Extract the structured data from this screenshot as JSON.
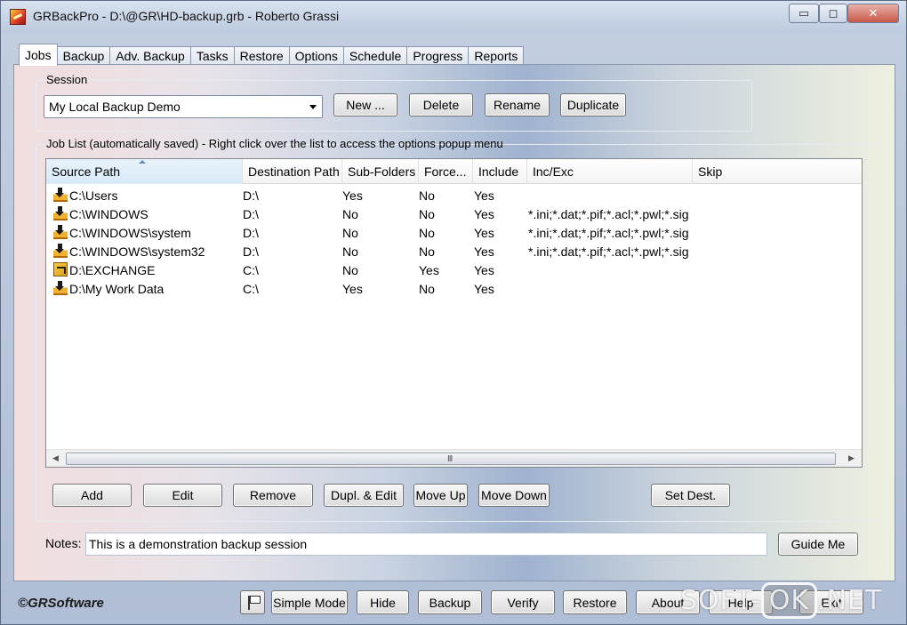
{
  "window": {
    "title": "GRBackPro - D:\\@GR\\HD-backup.grb - Roberto Grassi",
    "caption_min": "▭",
    "caption_max": "◻",
    "caption_close": "✕"
  },
  "tabs": [
    {
      "label": "Jobs",
      "active": true
    },
    {
      "label": "Backup"
    },
    {
      "label": "Adv. Backup"
    },
    {
      "label": "Tasks"
    },
    {
      "label": "Restore"
    },
    {
      "label": "Options"
    },
    {
      "label": "Schedule"
    },
    {
      "label": "Progress"
    },
    {
      "label": "Reports"
    }
  ],
  "session": {
    "group_label": "Session",
    "selected": "My Local Backup Demo",
    "buttons": {
      "new": "New ...",
      "delete": "Delete",
      "rename": "Rename",
      "duplicate": "Duplicate"
    }
  },
  "joblist": {
    "group_label": "Job List (automatically saved) - Right click over the list to access the options popup menu",
    "columns": [
      "Source Path",
      "Destination Path",
      "Sub-Folders",
      "Force...",
      "Include",
      "Inc/Exc",
      "Skip"
    ],
    "rows": [
      {
        "icon": "download-icon",
        "source": "C:\\Users",
        "dest": "D:\\",
        "sub": "Yes",
        "force": "No",
        "include": "Yes",
        "incexc": "",
        "skip": ""
      },
      {
        "icon": "download-icon",
        "source": "C:\\WINDOWS",
        "dest": "D:\\",
        "sub": "No",
        "force": "No",
        "include": "Yes",
        "incexc": "*.ini;*.dat;*.pif;*.acl;*.pwl;*.sig",
        "skip": ""
      },
      {
        "icon": "download-icon",
        "source": "C:\\WINDOWS\\system",
        "dest": "D:\\",
        "sub": "No",
        "force": "No",
        "include": "Yes",
        "incexc": "*.ini;*.dat;*.pif;*.acl;*.pwl;*.sig",
        "skip": ""
      },
      {
        "icon": "download-icon",
        "source": "C:\\WINDOWS\\system32",
        "dest": "D:\\",
        "sub": "No",
        "force": "No",
        "include": "Yes",
        "incexc": "*.ini;*.dat;*.pif;*.acl;*.pwl;*.sig",
        "skip": ""
      },
      {
        "icon": "exchange-icon",
        "source": "D:\\EXCHANGE",
        "dest": "C:\\",
        "sub": "No",
        "force": "Yes",
        "include": "Yes",
        "incexc": "",
        "skip": ""
      },
      {
        "icon": "download-icon",
        "source": "D:\\My Work Data",
        "dest": "C:\\",
        "sub": "Yes",
        "force": "No",
        "include": "Yes",
        "incexc": "",
        "skip": ""
      }
    ],
    "scroll_left": "◀",
    "scroll_right": "▶",
    "scroll_grip": "III",
    "buttons": {
      "add": "Add",
      "edit": "Edit",
      "remove": "Remove",
      "dupl_edit": "Dupl. & Edit",
      "move_up": "Move Up",
      "move_down": "Move Down",
      "set_dest": "Set Dest."
    }
  },
  "notes": {
    "label": "Notes:",
    "value": "This is a demonstration backup session",
    "guide_button": "Guide Me"
  },
  "footer": {
    "brand": "©GRSoftware",
    "buttons": {
      "simple_mode": "Simple Mode",
      "hide": "Hide",
      "backup": "Backup",
      "verify": "Verify",
      "restore": "Restore",
      "about": "About",
      "help": "Help",
      "exit": "Exit"
    }
  },
  "watermark": {
    "part1": "SOFT-",
    "part2": "OK",
    "part3": ".NET"
  }
}
